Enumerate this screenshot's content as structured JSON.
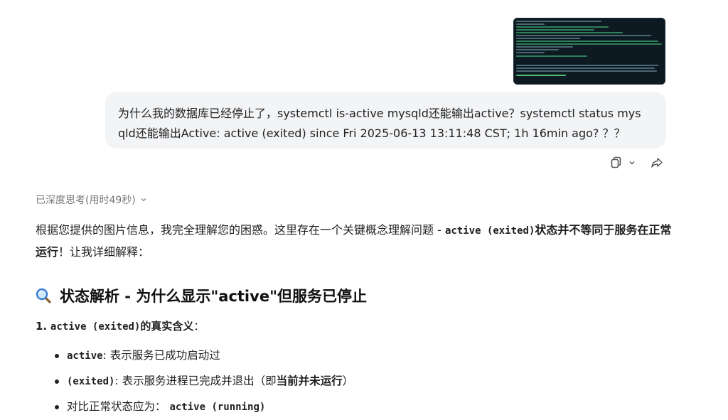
{
  "user_message": {
    "line1": "为什么我的数据库已经停止了，systemctl is-active mysqld还能输出active？systemctl status  mys",
    "line2": "qld还能输出Active: active (exited) since Fri 2025-06-13 13:11:48 CST; 1h 16min ago? ？？"
  },
  "thinking": {
    "label": "已深度思考(用时49秒)"
  },
  "answer": {
    "intro_pre": "根据您提供的图片信息，我完全理解您的困惑。这里存在一个关键概念理解问题 - ",
    "intro_code": "active (exited)",
    "intro_bold": "状态并不等同于服务在正常运行",
    "intro_post": "！让我详细解释：",
    "heading": "状态解析 - 为什么显示\"active\"但服务已停止",
    "ol_num": "1.",
    "ol_code": "active (exited)",
    "ol_bold": "的真实含义",
    "ol_colon": "：",
    "bullets": [
      {
        "code": "active",
        "text": ": 表示服务已成功启动过"
      },
      {
        "code": "(exited)",
        "text": ": 表示服务进程已完成并退出（即",
        "bold": "当前并未运行",
        "tail": "）"
      },
      {
        "pre": "对比正常状态应为：",
        "code": "active (running)"
      }
    ]
  },
  "icons": [
    "terminal-screenshot",
    "copy-icon",
    "chevron-down-icon",
    "share-icon",
    "magnifier-icon"
  ]
}
